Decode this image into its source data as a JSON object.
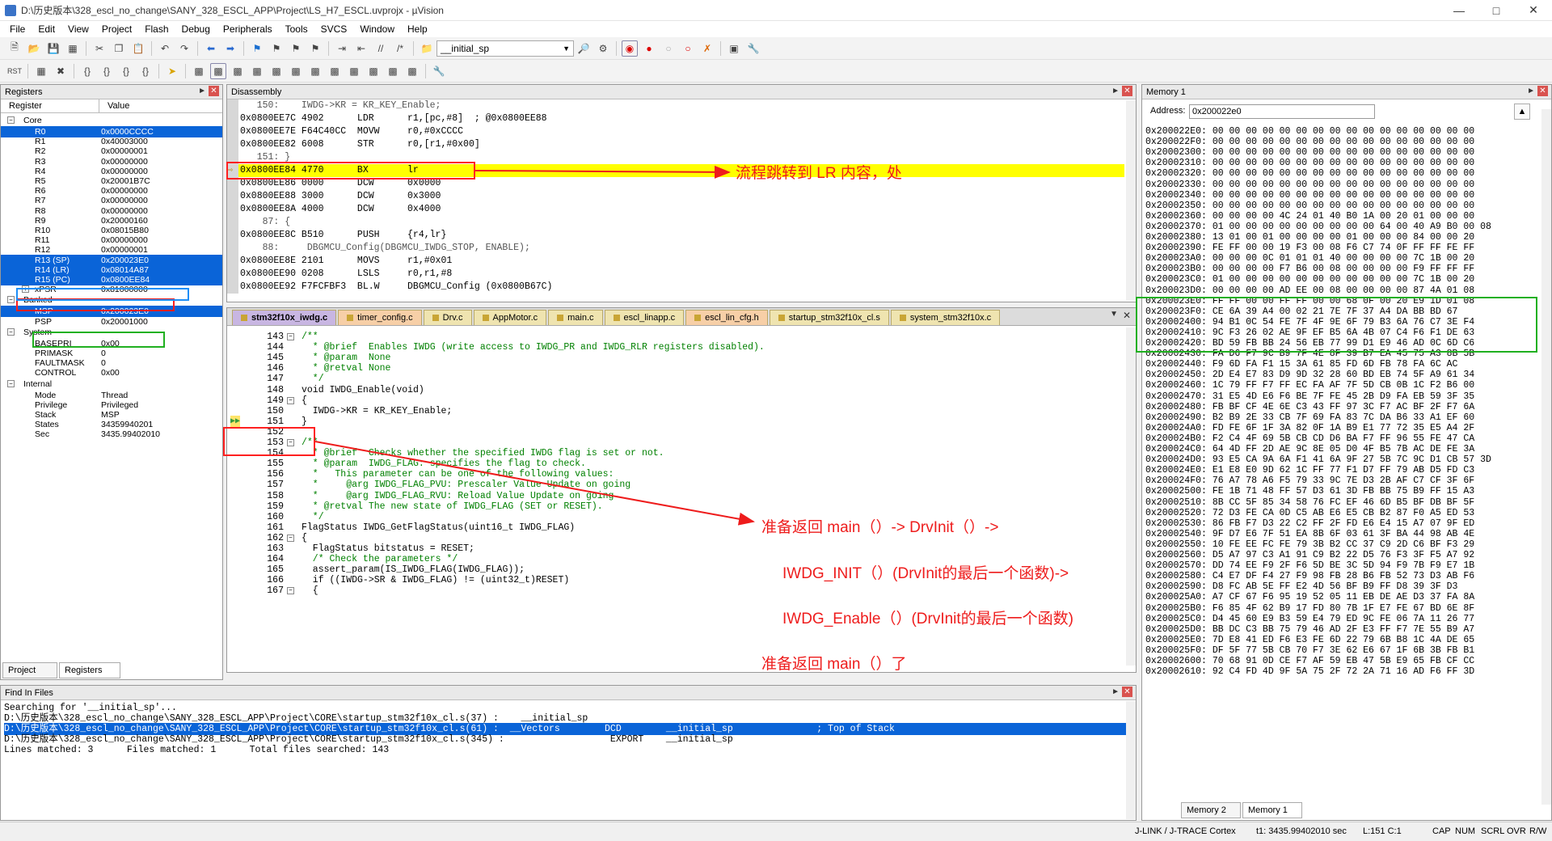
{
  "window": {
    "title": "D:\\历史版本\\328_escl_no_change\\SANY_328_ESCL_APP\\Project\\LS_H7_ESCL.uvprojx - µVision"
  },
  "menu": [
    "File",
    "Edit",
    "View",
    "Project",
    "Flash",
    "Debug",
    "Peripherals",
    "Tools",
    "SVCS",
    "Window",
    "Help"
  ],
  "toolbar": {
    "find_combo": "__initial_sp"
  },
  "registers": {
    "title": "Registers",
    "col_register": "Register",
    "col_value": "Value",
    "groups": {
      "core": "Core",
      "banked": "Banked",
      "system": "System",
      "internal": "Internal"
    },
    "core": [
      {
        "name": "R0",
        "value": "0x0000CCCC",
        "sel": true
      },
      {
        "name": "R1",
        "value": "0x40003000"
      },
      {
        "name": "R2",
        "value": "0x00000001"
      },
      {
        "name": "R3",
        "value": "0x00000000"
      },
      {
        "name": "R4",
        "value": "0x00000000"
      },
      {
        "name": "R5",
        "value": "0x20001B7C"
      },
      {
        "name": "R6",
        "value": "0x00000000"
      },
      {
        "name": "R7",
        "value": "0x00000000"
      },
      {
        "name": "R8",
        "value": "0x00000000"
      },
      {
        "name": "R9",
        "value": "0x20000160"
      },
      {
        "name": "R10",
        "value": "0x08015B80"
      },
      {
        "name": "R11",
        "value": "0x00000000"
      },
      {
        "name": "R12",
        "value": "0x00000001"
      },
      {
        "name": "R13 (SP)",
        "value": "0x200023E0",
        "sel": true
      },
      {
        "name": "R14 (LR)",
        "value": "0x08014A87",
        "sel": true
      },
      {
        "name": "R15 (PC)",
        "value": "0x0800EE84",
        "sel": true
      },
      {
        "name": "xPSR",
        "value": "0x81000000"
      }
    ],
    "banked": [
      {
        "name": "MSP",
        "value": "0x200023E0",
        "sel": true
      },
      {
        "name": "PSP",
        "value": "0x20001000"
      }
    ],
    "system": [
      {
        "name": "BASEPRI",
        "value": "0x00"
      },
      {
        "name": "PRIMASK",
        "value": "0"
      },
      {
        "name": "FAULTMASK",
        "value": "0"
      },
      {
        "name": "CONTROL",
        "value": "0x00"
      }
    ],
    "internal": [
      {
        "name": "Mode",
        "value": "Thread"
      },
      {
        "name": "Privilege",
        "value": "Privileged"
      },
      {
        "name": "Stack",
        "value": "MSP"
      },
      {
        "name": "States",
        "value": "34359940201"
      },
      {
        "name": "Sec",
        "value": "3435.99402010"
      }
    ],
    "tab_project": "Project",
    "tab_registers": "Registers"
  },
  "disasm": {
    "title": "Disassembly",
    "lines": [
      "   150:    IWDG->KR = KR_KEY_Enable;",
      "0x0800EE7C 4902      LDR      r1,[pc,#8]  ; @0x0800EE88",
      "0x0800EE7E F64C40CC  MOVW     r0,#0xCCCC",
      "0x0800EE82 6008      STR      r0,[r1,#0x00]",
      "   151: }",
      "0x0800EE84 4770      BX       lr",
      "0x0800EE86 0000      DCW      0x0000",
      "0x0800EE88 3000      DCW      0x3000",
      "0x0800EE8A 4000      DCW      0x4000",
      "    87: {",
      "0x0800EE8C B510      PUSH     {r4,lr}",
      "    88:     DBGMCU_Config(DBGMCU_IWDG_STOP, ENABLE);",
      "0x0800EE8E 2101      MOVS     r1,#0x01",
      "0x0800EE90 0208      LSLS     r0,r1,#8",
      "0x0800EE92 F7FCFBF3  BL.W     DBGMCU_Config (0x0800B67C)"
    ]
  },
  "editor": {
    "tabs": [
      "stm32f10x_iwdg.c",
      "timer_config.c",
      "Drv.c",
      "AppMotor.c",
      "main.c",
      "escl_linapp.c",
      "escl_lin_cfg.h",
      "startup_stm32f10x_cl.s",
      "system_stm32f10x.c"
    ],
    "lines": [
      {
        "n": "143",
        "t": "/**"
      },
      {
        "n": "144",
        "t": "  * @brief  Enables IWDG (write access to IWDG_PR and IWDG_RLR registers disabled)."
      },
      {
        "n": "145",
        "t": "  * @param  None"
      },
      {
        "n": "146",
        "t": "  * @retval None"
      },
      {
        "n": "147",
        "t": "  */"
      },
      {
        "n": "148",
        "t": "void IWDG_Enable(void)"
      },
      {
        "n": "149",
        "t": "{"
      },
      {
        "n": "150",
        "t": "  IWDG->KR = KR_KEY_Enable;"
      },
      {
        "n": "151",
        "t": "}"
      },
      {
        "n": "152",
        "t": ""
      },
      {
        "n": "153",
        "t": "/**"
      },
      {
        "n": "154",
        "t": "  * @brief  Checks whether the specified IWDG flag is set or not."
      },
      {
        "n": "155",
        "t": "  * @param  IWDG_FLAG: specifies the flag to check."
      },
      {
        "n": "156",
        "t": "  *   This parameter can be one of the following values:"
      },
      {
        "n": "157",
        "t": "  *     @arg IWDG_FLAG_PVU: Prescaler Value Update on going"
      },
      {
        "n": "158",
        "t": "  *     @arg IWDG_FLAG_RVU: Reload Value Update on going"
      },
      {
        "n": "159",
        "t": "  * @retval The new state of IWDG_FLAG (SET or RESET)."
      },
      {
        "n": "160",
        "t": "  */"
      },
      {
        "n": "161",
        "t": "FlagStatus IWDG_GetFlagStatus(uint16_t IWDG_FLAG)"
      },
      {
        "n": "162",
        "t": "{"
      },
      {
        "n": "163",
        "t": "  FlagStatus bitstatus = RESET;"
      },
      {
        "n": "164",
        "t": "  /* Check the parameters */"
      },
      {
        "n": "165",
        "t": "  assert_param(IS_IWDG_FLAG(IWDG_FLAG));"
      },
      {
        "n": "166",
        "t": "  if ((IWDG->SR & IWDG_FLAG) != (uint32_t)RESET)"
      },
      {
        "n": "167",
        "t": "  {"
      }
    ]
  },
  "find": {
    "title": "Find In Files",
    "lines": [
      "Searching for '__initial_sp'...",
      "D:\\历史版本\\328_escl_no_change\\SANY_328_ESCL_APP\\Project\\CORE\\startup_stm32f10x_cl.s(37) :    __initial_sp",
      "D:\\历史版本\\328_escl_no_change\\SANY_328_ESCL_APP\\Project\\CORE\\startup_stm32f10x_cl.s(61) :  __Vectors        DCD        __initial_sp               ; Top of Stack",
      "D:\\历史版本\\328_escl_no_change\\SANY_328_ESCL_APP\\Project\\CORE\\startup_stm32f10x_cl.s(345) :                   EXPORT    __initial_sp",
      "Lines matched: 3      Files matched: 1      Total files searched: 143"
    ]
  },
  "memory": {
    "title": "Memory 1",
    "address_label": "Address:",
    "address_value": "0x200022e0",
    "lines": [
      "0x200022E0: 00 00 00 00 00 00 00 00 00 00 00 00 00 00 00 00",
      "0x200022F0: 00 00 00 00 00 00 00 00 00 00 00 00 00 00 00 00",
      "0x20002300: 00 00 00 00 00 00 00 00 00 00 00 00 00 00 00 00",
      "0x20002310: 00 00 00 00 00 00 00 00 00 00 00 00 00 00 00 00",
      "0x20002320: 00 00 00 00 00 00 00 00 00 00 00 00 00 00 00 00",
      "0x20002330: 00 00 00 00 00 00 00 00 00 00 00 00 00 00 00 00",
      "0x20002340: 00 00 00 00 00 00 00 00 00 00 00 00 00 00 00 00",
      "0x20002350: 00 00 00 00 00 00 00 00 00 00 00 00 00 00 00 00",
      "0x20002360: 00 00 00 00 4C 24 01 40 B0 1A 00 20 01 00 00 00",
      "0x20002370: 01 00 00 00 00 00 00 00 00 00 64 00 40 A9 B0 00 08",
      "0x20002380: 13 01 00 01 00 00 00 00 01 00 00 00 84 00 00 20",
      "0x20002390: FE FF 00 00 19 F3 00 08 F6 C7 74 0F FF FF FE FF",
      "0x200023A0: 00 00 00 0C 01 01 01 40 00 00 00 00 7C 1B 00 20",
      "0x200023B0: 00 00 00 00 F7 B6 00 08 00 00 00 00 F9 FF FF FF",
      "0x200023C0: 01 00 00 00 00 00 00 00 00 00 00 00 7C 1B 00 20",
      "0x200023D0: 00 00 00 00 AD EE 00 08 00 00 00 00 87 4A 01 08",
      "0x200023E0: FF FF 00 00 FF FF 00 00 68 0F 00 20 E9 1D 01 08",
      "0x200023F0: CE 6A 39 A4 00 02 21 7E 7F 37 A4 DA BB BD 67",
      "0x20002400: 94 B1 0C 54 FE 7F 4F 9E 6F 79 B3 6A 76 C7 3E F4",
      "0x20002410: 9C F3 26 02 AE 9F EF B5 6A 4B 07 C4 F6 F1 DE 63",
      "0x20002420: BD 59 FB BB 24 56 EB 77 99 D1 E9 46 AD 0C 6D C6",
      "0x20002430: FA D6 F7 9C B9 7F 4E 8F 39 B7 EA 45 75 A3 8B 5B",
      "0x20002440: F9 6D FA F1 15 3A 61 85 FD 6D FB 78 FA 6C AC",
      "0x20002450: 2D E4 E7 83 D9 9D 32 28 60 BD EB 74 5F A9 61 34",
      "0x20002460: 1C 79 FF F7 FF EC FA AF 7F 5D CB 0B 1C F2 B6 00",
      "0x20002470: 31 E5 4D E6 F6 BE 7F FE 45 2B D9 FA EB 59 3F 35",
      "0x20002480: FB BF CF 4E 6E C3 43 FF 97 3C F7 AC BF 2F F7 6A",
      "0x20002490: B2 B9 2E 33 CB 7F 69 FA 83 7C DA B6 33 A1 EF 60",
      "0x200024A0: FD FE 6F 1F 3A 82 0F 1A B9 E1 77 72 35 E5 A4 2F",
      "0x200024B0: F2 C4 4F 69 5B CB CD D6 BA F7 FF 96 55 FE 47 CA",
      "0x200024C0: 64 4D FF 2D AE 9C 8E 05 D0 4F B5 7B AC DE FE 3A",
      "0x200024D0: 93 E5 CA 9A 6A F1 41 6A 9F 27 5B 7C 9C D1 CB 57 3D",
      "0x200024E0: E1 E8 E0 9D 62 1C FF 77 F1 D7 FF 79 AB D5 FD C3",
      "0x200024F0: 76 A7 78 A6 F5 79 33 9C 7E D3 2B AF C7 CF 3F 6F",
      "0x20002500: FE 1B 71 48 FF 57 D3 61 3D FB BB 75 B9 FF 15 A3",
      "0x20002510: 8B CC 5F 85 34 58 76 FC EF 46 6D B5 BF DB BF 5F",
      "0x20002520: 72 D3 FE CA 0D C5 AB E6 E5 CB B2 87 F0 A5 ED 53",
      "0x20002530: 86 FB F7 D3 22 C2 FF 2F FD E6 E4 15 A7 07 9F ED",
      "0x20002540: 9F D7 E6 7F 51 EA 8B 6F 03 61 3F BA 44 98 AB 4E",
      "0x20002550: 10 FE EE FC FE 79 3B B2 CC 37 C9 2D C6 BF F3 29",
      "0x20002560: D5 A7 97 C3 A1 91 C9 B2 22 D5 76 F3 3F F5 A7 92",
      "0x20002570: DD 74 EE F9 2F F6 5D BE 3C 5D 94 F9 7B F9 E7 1B",
      "0x20002580: C4 E7 DF F4 27 F9 98 FB 28 B6 FB 52 73 D3 AB F6",
      "0x20002590: D8 FC AB 5E FF E2 4D 56 BF B9 FF D8 39 3F D3",
      "0x200025A0: A7 CF 67 F6 95 19 52 05 11 EB DE AE D3 37 FA 8A",
      "0x200025B0: F6 85 4F 62 B9 17 FD 80 7B 1F E7 FE 67 BD 6E 8F",
      "0x200025C0: D4 45 60 E9 B3 59 E4 79 ED 9C FE 06 7A 11 26 77",
      "0x200025D0: BB DC C3 BB 75 79 46 AD 2F E3 FF F7 7E 55 B9 A7",
      "0x200025E0: 7D E8 41 ED F6 E3 FE 6D 22 79 6B B8 1C 4A DE 65",
      "0x200025F0: DF 5F 77 5B CB 70 F7 3E 62 E6 67 1F 6B 3B FB B1",
      "0x20002600: 70 68 91 0D CE F7 AF 59 EB 47 5B E9 65 FB CF CC",
      "0x20002610: 92 C4 FD 4D 9F 5A 75 2F 72 2A 71 16 AD F6 FF 3D"
    ],
    "tab_memory2": "Memory 2",
    "tab_memory1": "Memory 1"
  },
  "annotations": {
    "a1": "流程跳转到 LR 内容，处",
    "a2": "准备返回 main（）-> DrvInit（）->",
    "a3": "IWDG_INIT（）(DrvInit的最后一个函数)->",
    "a4": "IWDG_Enable（）(DrvInit的最后一个函数)",
    "a5": "准备返回 main（）了"
  },
  "status": {
    "debugger": "J-LINK / J-TRACE Cortex",
    "time": "t1: 3435.99402010 sec",
    "pos": "L:151 C:1",
    "caps": "CAP",
    "num": "NUM",
    "scrl": "SCRL",
    "ovr": "OVR",
    "rw": "R/W"
  }
}
